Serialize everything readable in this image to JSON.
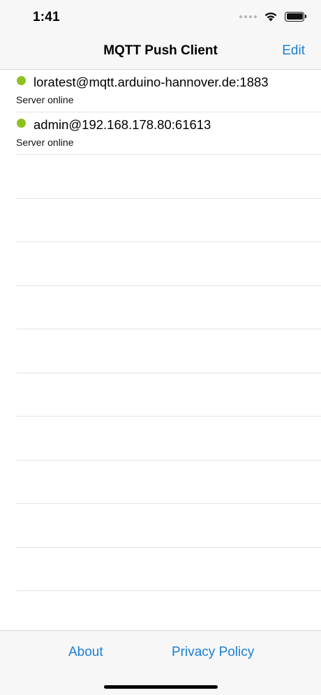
{
  "status_bar": {
    "time": "1:41"
  },
  "nav": {
    "title": "MQTT Push Client",
    "edit_label": "Edit"
  },
  "colors": {
    "accent": "#1a7fd4",
    "online": "#8dc21f"
  },
  "servers": [
    {
      "name": "loratest@mqtt.arduino-hannover.de:1883",
      "status": "Server online"
    },
    {
      "name": "admin@192.168.178.80:61613",
      "status": "Server online"
    }
  ],
  "tab_bar": {
    "about_label": "About",
    "privacy_label": "Privacy Policy"
  }
}
